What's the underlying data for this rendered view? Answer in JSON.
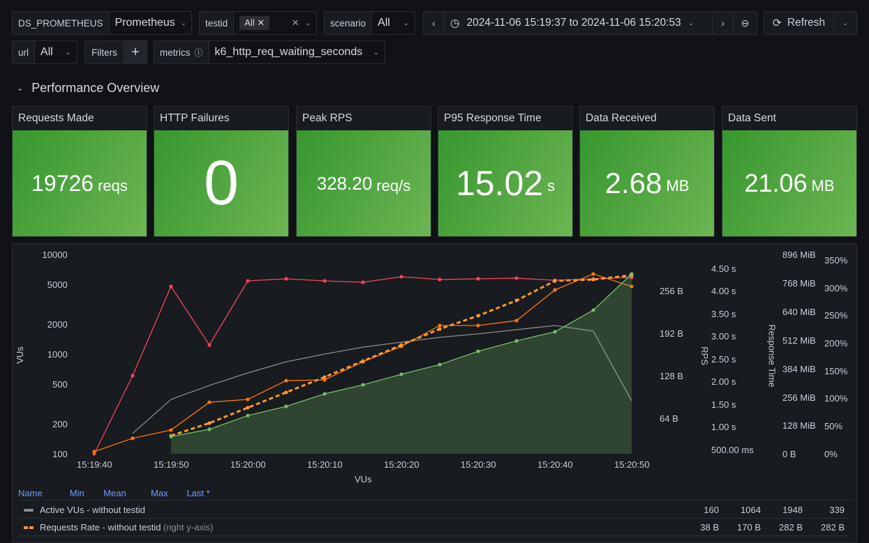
{
  "vars": {
    "ds": {
      "label": "DS_PROMETHEUS",
      "value": "Prometheus"
    },
    "testid": {
      "label": "testid",
      "chip": "All"
    },
    "scenario": {
      "label": "scenario",
      "value": "All"
    },
    "url": {
      "label": "url",
      "value": "All"
    },
    "filters": {
      "label": "Filters"
    },
    "metrics": {
      "label": "metrics",
      "value": "k6_http_req_waiting_seconds"
    }
  },
  "time": {
    "range": "2024-11-06 15:19:37 to 2024-11-06 15:20:53",
    "refresh": "Refresh"
  },
  "row": {
    "title": "Performance Overview"
  },
  "stats": [
    {
      "title": "Requests Made",
      "value": "19726",
      "unit": "reqs"
    },
    {
      "title": "HTTP Failures",
      "value": "0",
      "unit": ""
    },
    {
      "title": "Peak RPS",
      "value": "328.20",
      "unit": "req/s"
    },
    {
      "title": "P95 Response Time",
      "value": "15.02",
      "unit": "s"
    },
    {
      "title": "Data Received",
      "value": "2.68",
      "unit": "MB"
    },
    {
      "title": "Data Sent",
      "value": "21.06",
      "unit": "MB"
    }
  ],
  "colors": {
    "stat_bg": "#56a64b",
    "red": "#f2495c",
    "orange": "#ff780a",
    "orange_dashed": "#ff9830",
    "green": "#73bf69",
    "gray": "#8e8e8e",
    "header_blue": "#6e9fff"
  },
  "chart_data": {
    "type": "line",
    "xlabel": "VUs",
    "ylabel": "VUs",
    "yscale": "log",
    "ylim": [
      100,
      10000
    ],
    "x": [
      "15:19:40",
      "15:19:45",
      "15:19:50",
      "15:19:55",
      "15:20:00",
      "15:20:05",
      "15:20:10",
      "15:20:15",
      "15:20:20",
      "15:20:25",
      "15:20:30",
      "15:20:35",
      "15:20:40",
      "15:20:45",
      "15:20:50"
    ],
    "x_ticks": [
      "15:19:40",
      "15:19:50",
      "15:20:00",
      "15:20:10",
      "15:20:20",
      "15:20:30",
      "15:20:40",
      "15:20:50"
    ],
    "y_ticks": [
      "10000",
      "5000",
      "2000",
      "1000",
      "500",
      "200",
      "100"
    ],
    "right_axes": [
      {
        "label": "",
        "ticks": [
          "256 B",
          "192 B",
          "128 B",
          "64 B"
        ]
      },
      {
        "label": "RPS",
        "ticks": [
          "4.50 s",
          "4.00 s",
          "3.50 s",
          "3.00 s",
          "2.50 s",
          "2.00 s",
          "1.50 s",
          "1.00 s",
          "500.00 ms"
        ]
      },
      {
        "label": "Response Time",
        "ticks": [
          "896 MiB",
          "768 MiB",
          "640 MiB",
          "512 MiB",
          "384 MiB",
          "256 MiB",
          "128 MiB",
          "0 B"
        ]
      },
      {
        "label": "",
        "ticks": [
          "350%",
          "300%",
          "250%",
          "200%",
          "150%",
          "100%",
          "50%",
          "0%"
        ]
      }
    ],
    "series": [
      {
        "key": "red",
        "color": "#f2495c",
        "values": [
          100,
          607,
          4768,
          1233,
          5425,
          5690,
          5425,
          5250,
          5970,
          5600,
          5690,
          5780,
          5500,
          5690,
          5880
        ]
      },
      {
        "key": "gray",
        "name": "Active VUs - without testid",
        "color": "#8e8e8e",
        "values": [
          null,
          160,
          351,
          485,
          647,
          838,
          1000,
          1175,
          1318,
          1472,
          1596,
          1758,
          1936,
          1702,
          340
        ]
      },
      {
        "key": "orange",
        "color": "#ff780a",
        "values": [
          105,
          143,
          173,
          329,
          351,
          542,
          551,
          838,
          1194,
          1936,
          1936,
          2168,
          4400,
          6370,
          4768
        ]
      },
      {
        "key": "orange_dashed",
        "name": "Requests Rate - without testid",
        "color": "#ff9830",
        "dashed": true,
        "values": [
          null,
          null,
          152,
          203,
          290,
          413,
          588,
          851,
          1233,
          1786,
          2426,
          3452,
          5425,
          5600,
          6170
        ]
      },
      {
        "key": "green",
        "color": "#73bf69",
        "fill": true,
        "values": [
          null,
          null,
          149,
          176,
          242,
          299,
          399,
          492,
          627,
          785,
          1067,
          1358,
          1675,
          2760,
          6370
        ]
      }
    ]
  },
  "legend": {
    "headers": {
      "name": "Name",
      "min": "Min",
      "mean": "Mean",
      "max": "Max",
      "last": "Last *"
    },
    "rows": [
      {
        "name": "Active VUs - without testid",
        "note": "",
        "min": "160",
        "mean": "1064",
        "max": "1948",
        "last": "339",
        "color": "#8e8e8e"
      },
      {
        "name": "Requests Rate - without testid",
        "note": "(right y-axis)",
        "min": "38 B",
        "mean": "170 B",
        "max": "282 B",
        "last": "282 B",
        "color": "#ff9830"
      }
    ]
  }
}
